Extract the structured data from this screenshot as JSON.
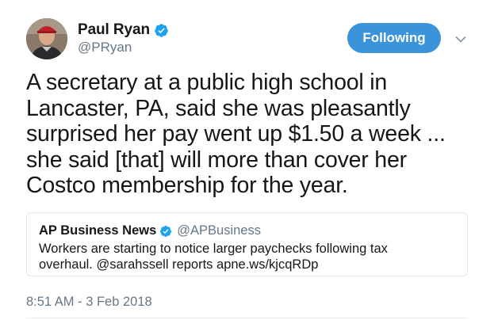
{
  "author": {
    "display_name": "Paul Ryan",
    "handle": "@PRyan",
    "verified": true,
    "avatar": "avatar-photo"
  },
  "follow_button": {
    "label": "Following",
    "color": "#3b94d9"
  },
  "menu_icon": "chevron-down-icon",
  "tweet": {
    "lines": [
      "A secretary at a public high school in",
      "Lancaster, PA, said she was pleasantly",
      "surprised her pay went up $1.50 a week ...",
      "she said [that] will more than cover her",
      "Costco membership for the year."
    ],
    "timestamp": "8:51 AM - 3 Feb 2018"
  },
  "quoted_tweet": {
    "display_name": "AP Business News",
    "handle": "@APBusiness",
    "verified": true,
    "lines": [
      "Workers are starting to notice larger paychecks following tax",
      "overhaul. @sarahssell reports apne.ws/kjcqRDp"
    ]
  },
  "colors": {
    "text": "#14171a",
    "secondary": "#657786",
    "verified_badge": "#1da1f2",
    "border": "#e1e8ed"
  }
}
